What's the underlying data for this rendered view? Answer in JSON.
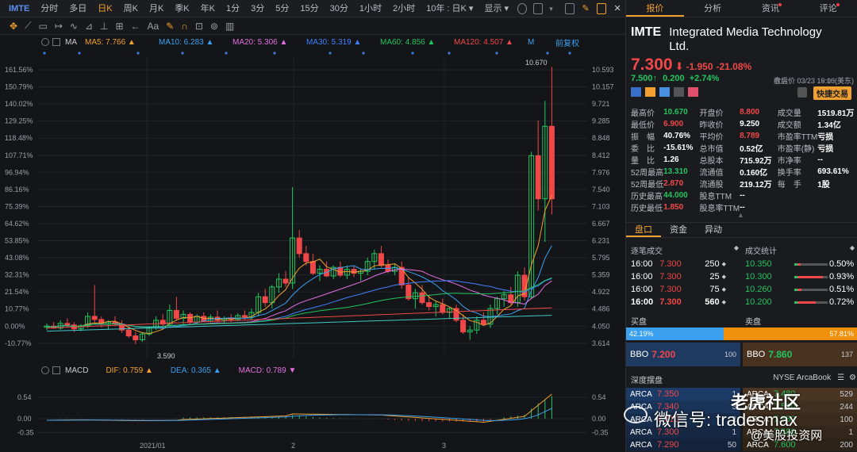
{
  "topbar": {
    "symbol": "IMTE",
    "tabs": [
      "分时",
      "多日",
      "日K",
      "周K",
      "月K",
      "季K",
      "年K",
      "1分",
      "3分",
      "5分",
      "15分",
      "30分",
      "1小时",
      "2小时",
      "10年 : 日K ▾",
      "显示 ▾"
    ],
    "active_tab": "日K"
  },
  "indicators": {
    "ma_label": "MA",
    "ma": [
      {
        "label": "MA5: 7.766 ▲",
        "color": "#f0a030"
      },
      {
        "label": "MA10: 6.283 ▲",
        "color": "#3ba0f0"
      },
      {
        "label": "MA20: 5.306 ▲",
        "color": "#e070e0"
      },
      {
        "label": "MA30: 5.319 ▲",
        "color": "#4080ff"
      },
      {
        "label": "MA60: 4.856 ▲",
        "color": "#22c55e"
      },
      {
        "label": "MA120: 4.507 ▲",
        "color": "#f04848"
      },
      {
        "label": "M",
        "color": "#3ba0f0"
      }
    ],
    "adjust": "前复权"
  },
  "main_axis": {
    "left": [
      "161.56%",
      "150.79%",
      "140.02%",
      "129.25%",
      "118.48%",
      "107.71%",
      "96.94%",
      "86.16%",
      "75.39%",
      "64.62%",
      "53.85%",
      "43.08%",
      "32.31%",
      "21.54%",
      "10.77%",
      "0.00%",
      "-10.77%"
    ],
    "right": [
      "10.593",
      "10.157",
      "9.721",
      "9.285",
      "8.848",
      "8.412",
      "7.976",
      "7.540",
      "7.103",
      "6.667",
      "6.231",
      "5.795",
      "5.359",
      "4.922",
      "4.486",
      "4.050",
      "3.614"
    ],
    "high_label": "10.670",
    "low_label": "3.590"
  },
  "macd": {
    "name": "MACD",
    "dif": "DIF: 0.759 ▲",
    "dea": "DEA: 0.365 ▲",
    "macd": "MACD: 0.789 ▼",
    "axis_left": [
      "0.54",
      "0.00",
      "-0.35"
    ],
    "axis_right": [
      "0.54",
      "0.00",
      "-0.35"
    ]
  },
  "xaxis": [
    "2021/01",
    "2",
    "3"
  ],
  "right_panel": {
    "tabs": [
      {
        "label": "报价",
        "active": true,
        "dot": false
      },
      {
        "label": "分析",
        "active": false,
        "dot": false
      },
      {
        "label": "资讯",
        "active": false,
        "dot": true
      },
      {
        "label": "评论",
        "active": false,
        "dot": true
      }
    ],
    "symbol": "IMTE",
    "name": "Integrated Media Technology Ltd.",
    "price": "7.300",
    "arrow": "⬇",
    "change": "-1.950",
    "change_pct": "-21.08%",
    "close_time": "收盘价 03/23 16:00(美东)",
    "ah_price": "7.500",
    "ah_arrow": "↑",
    "ah_change": "0.200",
    "ah_change_pct": "+2.74%",
    "ah_time": "盘后价 03/23 19:16(美东)",
    "quick_trade": "快捷交易",
    "stats": [
      [
        {
          "l": "最高价",
          "v": "10.670",
          "c": "green"
        },
        {
          "l": "开盘价",
          "v": "8.800",
          "c": "red"
        },
        {
          "l": "成交量",
          "v": "1519.81万",
          "c": "white"
        }
      ],
      [
        {
          "l": "最低价",
          "v": "6.900",
          "c": "red"
        },
        {
          "l": "昨收价",
          "v": "9.250",
          "c": "white"
        },
        {
          "l": "成交额",
          "v": "1.34亿",
          "c": "white"
        }
      ],
      [
        {
          "l": "振　幅",
          "v": "40.76%",
          "c": "white"
        },
        {
          "l": "平均价",
          "v": "8.789",
          "c": "red"
        },
        {
          "l": "市盈率TTM",
          "v": "亏损",
          "c": "white"
        }
      ],
      [
        {
          "l": "委　比",
          "v": "-15.61%",
          "c": "white"
        },
        {
          "l": "总市值",
          "v": "0.52亿",
          "c": "white"
        },
        {
          "l": "市盈率(静)",
          "v": "亏损",
          "c": "white"
        }
      ],
      [
        {
          "l": "量　比",
          "v": "1.26",
          "c": "white"
        },
        {
          "l": "总股本",
          "v": "715.92万",
          "c": "white"
        },
        {
          "l": "市净率",
          "v": "--",
          "c": "white"
        }
      ],
      [
        {
          "l": "52周最高",
          "v": "13.310",
          "c": "green"
        },
        {
          "l": "流通值",
          "v": "0.160亿",
          "c": "white"
        },
        {
          "l": "换手率",
          "v": "693.61%",
          "c": "white"
        }
      ],
      [
        {
          "l": "52周最低",
          "v": "2.870",
          "c": "red"
        },
        {
          "l": "流通股",
          "v": "219.12万",
          "c": "white"
        },
        {
          "l": "每　手",
          "v": "1股",
          "c": "white"
        }
      ],
      [
        {
          "l": "历史最高",
          "v": "44.000",
          "c": "green"
        },
        {
          "l": "股息TTM",
          "v": "--",
          "c": "white"
        },
        {
          "l": "",
          "v": "",
          "c": "white"
        }
      ],
      [
        {
          "l": "历史最低",
          "v": "1.850",
          "c": "red"
        },
        {
          "l": "股息率TTM",
          "v": "--",
          "c": "white"
        },
        {
          "l": "",
          "v": "",
          "c": "white"
        }
      ]
    ],
    "sub_tabs": [
      "盘口",
      "资金",
      "异动"
    ],
    "trades_title": "逐笔成交",
    "stats_title": "成交统计",
    "trades": [
      {
        "t": "16:00",
        "p": "7.300",
        "v": "250"
      },
      {
        "t": "16:00",
        "p": "7.300",
        "v": "25"
      },
      {
        "t": "16:00",
        "p": "7.300",
        "v": "75"
      },
      {
        "t": "16:00",
        "p": "7.300",
        "v": "560"
      }
    ],
    "volume_stats": [
      {
        "p": "10.350",
        "pct": "0.50%",
        "fill": 0.1
      },
      {
        "p": "10.300",
        "pct": "0.93%",
        "fill": 0.85
      },
      {
        "p": "10.260",
        "pct": "0.51%",
        "fill": 0.12
      },
      {
        "p": "10.200",
        "pct": "0.72%",
        "fill": 0.6
      }
    ],
    "buy_label": "买盘",
    "sell_label": "卖盘",
    "buy_pct": "42.19%",
    "sell_pct": "57.81%",
    "bbo_bid_label": "BBO",
    "bbo_bid": "7.200",
    "bbo_bid_size": "100",
    "bbo_ask_label": "BBO",
    "bbo_ask": "7.860",
    "bbo_ask_size": "137",
    "depth_title": "深度摆盘",
    "depth_source": "NYSE ArcaBook",
    "bids": [
      {
        "ex": "ARCA",
        "p": "7.350",
        "s": "1"
      },
      {
        "ex": "ARCA",
        "p": "7.340",
        "s": "3"
      },
      {
        "ex": "ARCA",
        "p": "7.310",
        "s": "2"
      },
      {
        "ex": "ARCA",
        "p": "7.300",
        "s": "1"
      },
      {
        "ex": "ARCA",
        "p": "7.290",
        "s": "50"
      }
    ],
    "asks": [
      {
        "ex": "ARCA",
        "p": "7.480",
        "s": "529"
      },
      {
        "ex": "ARCA",
        "p": "7.500",
        "s": "244"
      },
      {
        "ex": "ARCA",
        "p": "7.550",
        "s": "100"
      },
      {
        "ex": "ARCA",
        "p": "7.580",
        "s": "1"
      },
      {
        "ex": "ARCA",
        "p": "7.600",
        "s": "200"
      }
    ]
  },
  "watermark": {
    "line1": "老虎社区",
    "line2": "微信号: tradesmax",
    "line3": "@美股投资网"
  }
}
